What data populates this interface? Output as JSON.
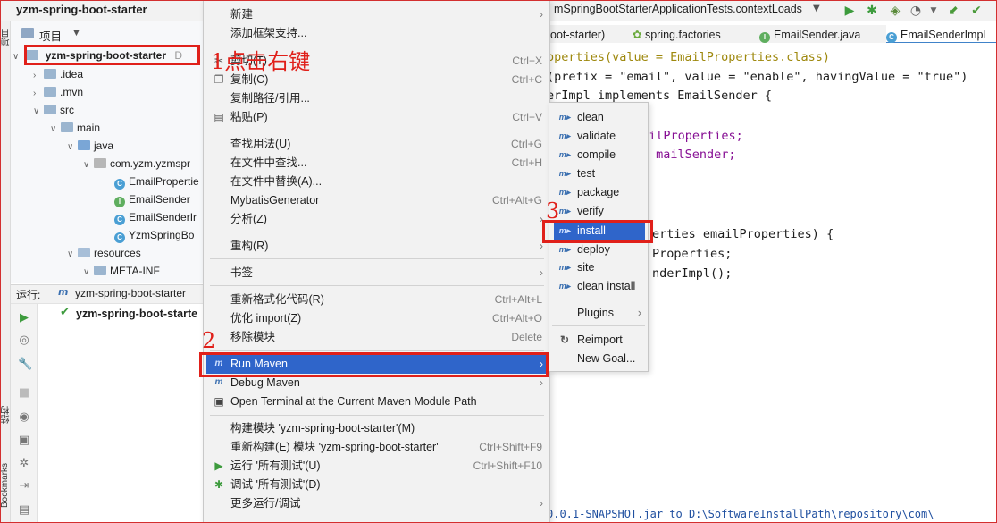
{
  "header": {
    "project_name": "yzm-spring-boot-starter",
    "run_config": "mSpringBootStarterApplicationTests.contextLoads"
  },
  "left_strip": {
    "project_tab": "项目",
    "structure_tab": "结构",
    "bookmarks_tab": "Bookmarks"
  },
  "project_panel": {
    "title": "项目",
    "root": {
      "name": "yzm-spring-boot-starter",
      "path_hint": "D"
    },
    "tree": [
      {
        "label": ".idea"
      },
      {
        "label": ".mvn"
      },
      {
        "label": "src"
      },
      {
        "label": "main"
      },
      {
        "label": "java"
      },
      {
        "label": "com.yzm.yzmspr"
      },
      {
        "label": "EmailPropertie"
      },
      {
        "label": "EmailSender"
      },
      {
        "label": "EmailSenderIr"
      },
      {
        "label": "YzmSpringBo"
      },
      {
        "label": "resources"
      },
      {
        "label": "META-INF"
      }
    ]
  },
  "run_panel": {
    "label": "运行:",
    "tab": "yzm-spring-boot-starter",
    "result": "yzm-spring-boot-starte"
  },
  "editor": {
    "tabs": [
      {
        "label": "oot-starter)"
      },
      {
        "label": "spring.factories"
      },
      {
        "label": "EmailSender.java"
      },
      {
        "label": "EmailSenderImpl"
      }
    ],
    "lines": [
      "operties(value = EmailProperties.class)",
      "(prefix = \"email\", value = \"enable\", havingValue = \"true\")",
      "erImpl implements EmailSender {",
      "ailProperties;",
      " mailSender;",
      "erties emailProperties) {",
      "Properties;",
      "nderImpl();"
    ],
    "console": "0.0.1-SNAPSHOT.jar to D:\\SoftwareInstallPath\\repository\\com\\"
  },
  "context_menu": {
    "items": [
      {
        "label": "新建",
        "shortcut": ""
      },
      {
        "label": "添加框架支持...",
        "shortcut": ""
      },
      {
        "label": "剪切(T)",
        "shortcut": "Ctrl+X"
      },
      {
        "label": "复制(C)",
        "shortcut": "Ctrl+C"
      },
      {
        "label": "复制路径/引用...",
        "shortcut": ""
      },
      {
        "label": "粘贴(P)",
        "shortcut": "Ctrl+V"
      },
      {
        "label": "查找用法(U)",
        "shortcut": "Ctrl+G"
      },
      {
        "label": "在文件中查找...",
        "shortcut": "Ctrl+H"
      },
      {
        "label": "在文件中替换(A)...",
        "shortcut": ""
      },
      {
        "label": "MybatisGenerator",
        "shortcut": "Ctrl+Alt+G"
      },
      {
        "label": "分析(Z)",
        "shortcut": ""
      },
      {
        "label": "重构(R)",
        "shortcut": ""
      },
      {
        "label": "书签",
        "shortcut": ""
      },
      {
        "label": "重新格式化代码(R)",
        "shortcut": "Ctrl+Alt+L"
      },
      {
        "label": "优化 import(Z)",
        "shortcut": "Ctrl+Alt+O"
      },
      {
        "label": "移除模块",
        "shortcut": "Delete"
      },
      {
        "label": "Run Maven",
        "shortcut": ""
      },
      {
        "label": "Debug Maven",
        "shortcut": ""
      },
      {
        "label": "Open Terminal at the Current Maven Module Path",
        "shortcut": ""
      },
      {
        "label": "构建模块 'yzm-spring-boot-starter'(M)",
        "shortcut": ""
      },
      {
        "label": "重新构建(E) 模块 'yzm-spring-boot-starter'",
        "shortcut": "Ctrl+Shift+F9"
      },
      {
        "label": "运行 '所有测试'(U)",
        "shortcut": "Ctrl+Shift+F10"
      },
      {
        "label": "调试 '所有测试'(D)",
        "shortcut": ""
      },
      {
        "label": "更多运行/调试",
        "shortcut": ""
      }
    ]
  },
  "maven_submenu": {
    "items": [
      {
        "label": "clean"
      },
      {
        "label": "validate"
      },
      {
        "label": "compile"
      },
      {
        "label": "test"
      },
      {
        "label": "package"
      },
      {
        "label": "verify"
      },
      {
        "label": "install"
      },
      {
        "label": "deploy"
      },
      {
        "label": "site"
      },
      {
        "label": "clean install"
      },
      {
        "label": "Plugins"
      },
      {
        "label": "Reimport"
      },
      {
        "label": "New Goal..."
      }
    ]
  },
  "annotations": {
    "step1": "1点击右键",
    "step2": "2",
    "step3": "3"
  },
  "colors": {
    "highlight": "#2f65ca",
    "annotation_red": "#e0201a",
    "menu_bg": "#f2f2f2"
  }
}
